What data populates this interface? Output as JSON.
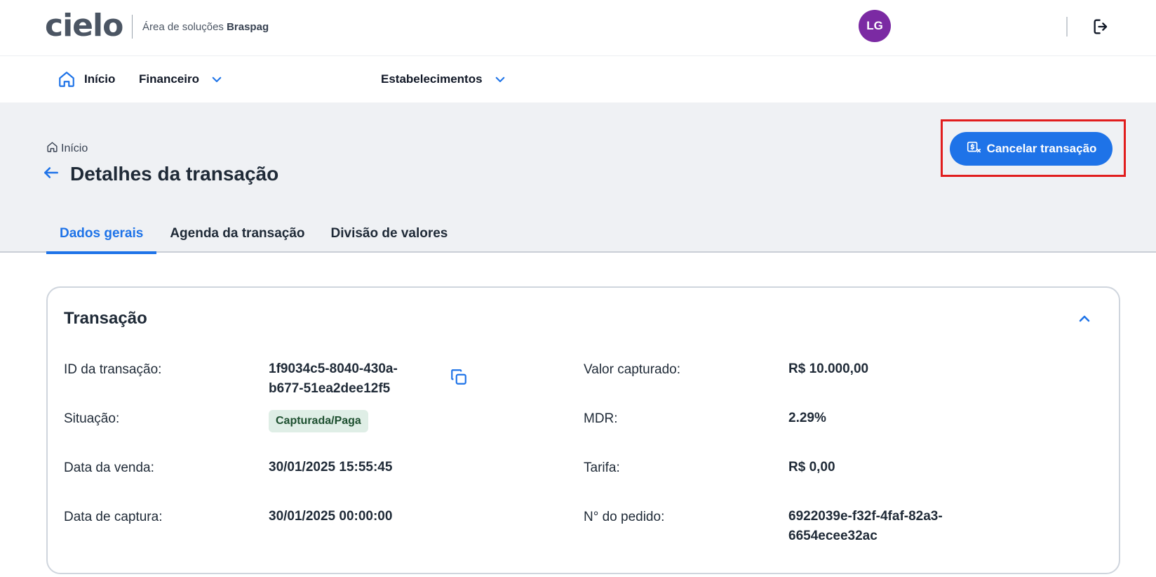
{
  "header": {
    "logo_text": "cielo",
    "subtitle_prefix": "Área de soluções",
    "subtitle_brand": "Braspag",
    "avatar_initials": "LG"
  },
  "nav": {
    "home": "Início",
    "finance": "Financeiro",
    "establishments": "Estabelecimentos"
  },
  "breadcrumb": {
    "home": "Início"
  },
  "page": {
    "title": "Detalhes da transação",
    "cancel_button": "Cancelar transação"
  },
  "tabs": [
    {
      "label": "Dados gerais",
      "active": true
    },
    {
      "label": "Agenda da transação",
      "active": false
    },
    {
      "label": "Divisão de valores",
      "active": false
    }
  ],
  "card": {
    "title": "Transação",
    "fields": {
      "transaction_id_label": "ID da transação:",
      "transaction_id_line1": "1f9034c5-8040-430a-",
      "transaction_id_line2": "b677-51ea2dee12f5",
      "status_label": "Situação:",
      "status_value": "Capturada/Paga",
      "sale_date_label": "Data da venda:",
      "sale_date_value": "30/01/2025 15:55:45",
      "capture_date_label": "Data de captura:",
      "capture_date_value": "30/01/2025 00:00:00",
      "captured_amount_label": "Valor capturado:",
      "captured_amount_value": "R$ 10.000,00",
      "mdr_label": "MDR:",
      "mdr_value": "2.29%",
      "fee_label": "Tarifa:",
      "fee_value": "R$ 0,00",
      "order_number_label": "N° do pedido:",
      "order_number_line1": "6922039e-f32f-4faf-82a3-",
      "order_number_line2": "6654ecee32ac"
    }
  },
  "colors": {
    "primary": "#1e73e8",
    "avatar": "#7b2aa3",
    "highlight": "#e11d1d",
    "status_badge_bg": "#dfeee6"
  }
}
